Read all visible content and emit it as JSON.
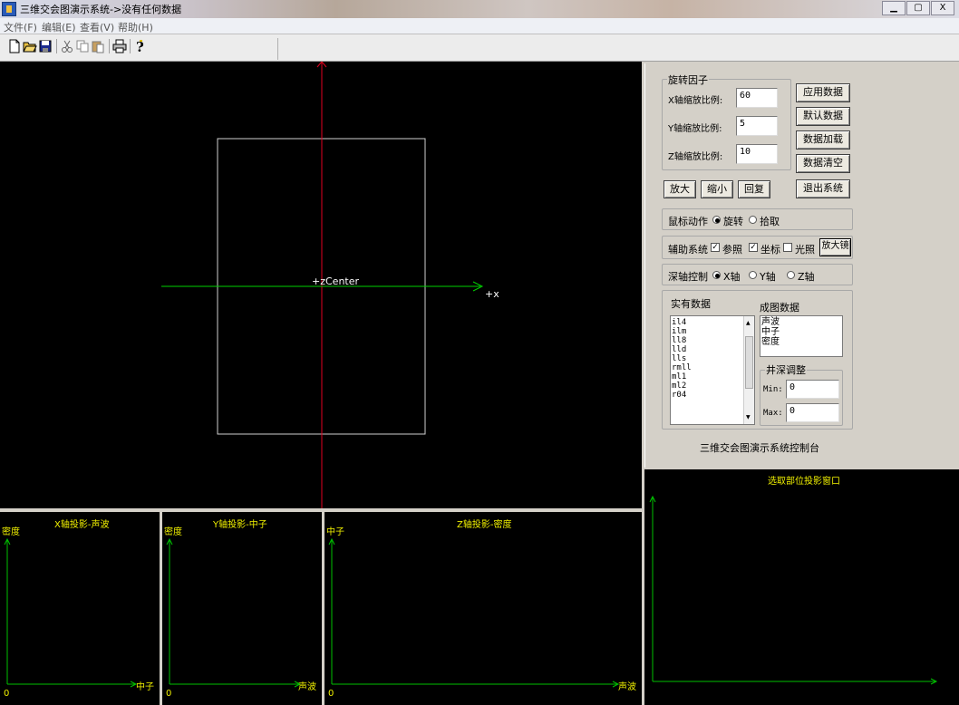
{
  "window": {
    "title": "三维交会图演示系统->没有任何数据",
    "min_glyph": "▁",
    "max_glyph": "▢",
    "close_glyph": "X"
  },
  "menu": [
    {
      "label": "文件(F)"
    },
    {
      "label": "编辑(E)"
    },
    {
      "label": "查看(V)"
    },
    {
      "label": "帮助(H)"
    }
  ],
  "toolbar_icons": [
    "new-file-icon",
    "open-folder-icon",
    "save-icon",
    "cut-icon",
    "copy-icon",
    "paste-icon",
    "print-icon",
    "help-icon"
  ],
  "main_view": {
    "center_label": "+zCenter",
    "x_axis_label": "+x"
  },
  "projections": {
    "x": {
      "title": "X轴投影-声波",
      "y_axis": "密度",
      "x_axis": "中子",
      "origin": "0"
    },
    "y": {
      "title": "Y轴投影-中子",
      "y_axis": "密度",
      "x_axis": "声波",
      "origin": "0"
    },
    "z": {
      "title": "Z轴投影-密度",
      "y_axis": "中子",
      "x_axis": "声波",
      "origin": "0"
    },
    "selection": {
      "title": "选取部位投影窗口"
    }
  },
  "control": {
    "rotation_group": "旋转因子",
    "x_scale_label": "X轴缩放比例:",
    "y_scale_label": "Y轴缩放比例:",
    "z_scale_label": "Z轴缩放比例:",
    "x_scale_value": "60",
    "y_scale_value": "5",
    "z_scale_value": "10",
    "apply_button": "应用数据",
    "default_button": "默认数据",
    "load_button": "数据加载",
    "clear_button": "数据清空",
    "zoom_in_button": "放大",
    "zoom_out_button": "缩小",
    "reset_button": "回复",
    "exit_button": "退出系统",
    "mouse_action_label": "鼠标动作",
    "mouse_rotate": "旋转",
    "mouse_pick": "拾取",
    "aux_system_label": "辅助系统",
    "aux_reference": "参照",
    "aux_coordinate": "坐标",
    "aux_light": "光照",
    "magnifier_button": "放大镜",
    "depth_axis_label": "深轴控制",
    "depth_x": "X轴",
    "depth_y": "Y轴",
    "depth_z": "Z轴",
    "existing_data_label": "实有数据",
    "chart_data_label": "成图数据",
    "existing_data": [
      "il4",
      "ilm",
      "ll8",
      "lld",
      "lls",
      "rmll",
      "ml1",
      "ml2",
      "r04"
    ],
    "chart_data": [
      "声波",
      "中子",
      "密度"
    ],
    "well_adjust_group": "井深调整",
    "min_label": "Min:",
    "max_label": "Max:",
    "min_value": "0",
    "max_value": "0",
    "footer": "三维交会图演示系统控制台"
  }
}
